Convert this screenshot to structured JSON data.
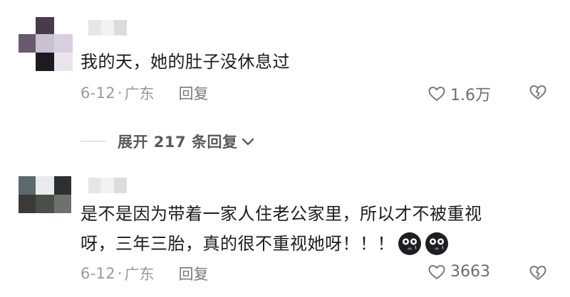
{
  "comments": [
    {
      "text_lines": [
        "我的天，她的肚子没休息过"
      ],
      "date": "6-12",
      "region": "广东",
      "reply_label": "回复",
      "likes": "1.6万"
    },
    {
      "text_lines": [
        "是不是因为带着一家人住老公家里，所以才不被重视",
        "呀，三年三胎，真的很不重视她呀！！！"
      ],
      "date": "6-12",
      "region": "广东",
      "reply_label": "回复",
      "likes": "3663",
      "emoji": [
        "crying-face-icon",
        "crying-face-icon"
      ]
    }
  ],
  "expand_replies_label": "展开 217 条回复",
  "colors": {
    "meta": "#9a9a9a",
    "text": "#1c1c1c",
    "icon": "#7a7a7a"
  }
}
